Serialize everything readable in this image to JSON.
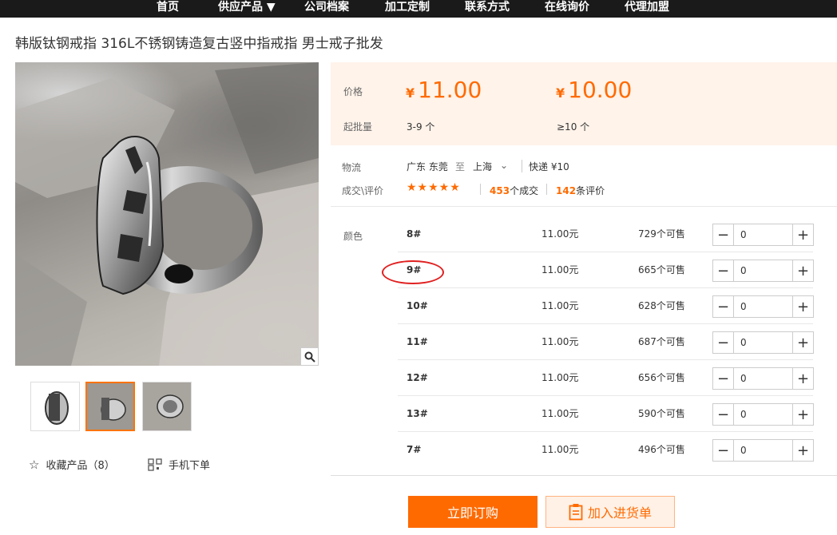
{
  "nav": {
    "items": [
      "首页",
      "供应产品 ▼",
      "公司档案",
      "加工定制",
      "联系方式",
      "在线询价",
      "代理加盟"
    ]
  },
  "product": {
    "title": "韩版钛钢戒指 316L不锈钢铸造复古竖中指戒指 男士戒子批发"
  },
  "gallery": {
    "thumb_count": 3,
    "active_thumb": 2
  },
  "actions": {
    "favorite_label": "收藏产品（8）",
    "mobile_label": "手机下单"
  },
  "pricing": {
    "price_label": "价格",
    "moq_label": "起批量",
    "currency": "¥",
    "tiers": [
      {
        "price": "11.00",
        "range": "3-9 个"
      },
      {
        "price": "10.00",
        "range": "≥10 个"
      }
    ]
  },
  "logistics": {
    "label": "物流",
    "from": "广东 东莞",
    "to_word": "至",
    "to": "上海",
    "express": "快递 ¥10"
  },
  "reviews": {
    "label": "成交\\评价",
    "stars": "★★★★★",
    "deals_count": "453",
    "deals_suffix": "个成交",
    "review_count": "142",
    "review_suffix": "条评价"
  },
  "sku": {
    "label": "颜色",
    "rows": [
      {
        "name": "8#",
        "price": "11.00元",
        "stock": "729个可售",
        "qty": "0"
      },
      {
        "name": "9#",
        "price": "11.00元",
        "stock": "665个可售",
        "qty": "0"
      },
      {
        "name": "10#",
        "price": "11.00元",
        "stock": "628个可售",
        "qty": "0"
      },
      {
        "name": "11#",
        "price": "11.00元",
        "stock": "687个可售",
        "qty": "0"
      },
      {
        "name": "12#",
        "price": "11.00元",
        "stock": "656个可售",
        "qty": "0"
      },
      {
        "name": "13#",
        "price": "11.00元",
        "stock": "590个可售",
        "qty": "0"
      },
      {
        "name": "7#",
        "price": "11.00元",
        "stock": "496个可售",
        "qty": "0"
      }
    ]
  },
  "buttons": {
    "order": "立即订购",
    "cart": "加入进货单"
  },
  "colors": {
    "accent": "#ff6a00",
    "nav_bg": "#1a1a1a",
    "price_bg": "#fff3ea",
    "highlight": "#e02020"
  }
}
